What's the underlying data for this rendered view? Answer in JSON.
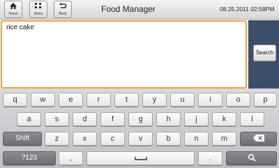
{
  "topbar": {
    "home_label": "Home",
    "menu_label": "Menu",
    "back_label": "Back",
    "title": "Food Manager",
    "datetime": "08.25.2011 02:58PM"
  },
  "input": {
    "value": "rice cake"
  },
  "search": {
    "label": "Search"
  },
  "keyboard": {
    "row1": [
      "q",
      "w",
      "e",
      "r",
      "t",
      "y",
      "u",
      "i",
      "o",
      "p"
    ],
    "row2": [
      "a",
      "s",
      "d",
      "f",
      "g",
      "h",
      "j",
      "k",
      "l"
    ],
    "row3": [
      "z",
      "x",
      "c",
      "v",
      "b",
      "n",
      "m"
    ],
    "shift_label": "Shift",
    "symbols_label": "?123",
    "comma": ",",
    "period": "."
  },
  "icons": {
    "home": "home-icon",
    "menu": "menu-grid-icon",
    "back": "back-arrow-icon",
    "backspace": "backspace-icon",
    "space": "space-bar-icon",
    "search": "magnifier-icon"
  },
  "colors": {
    "accent_border": "#f0a040",
    "side_panel": "#3c4f6a"
  }
}
